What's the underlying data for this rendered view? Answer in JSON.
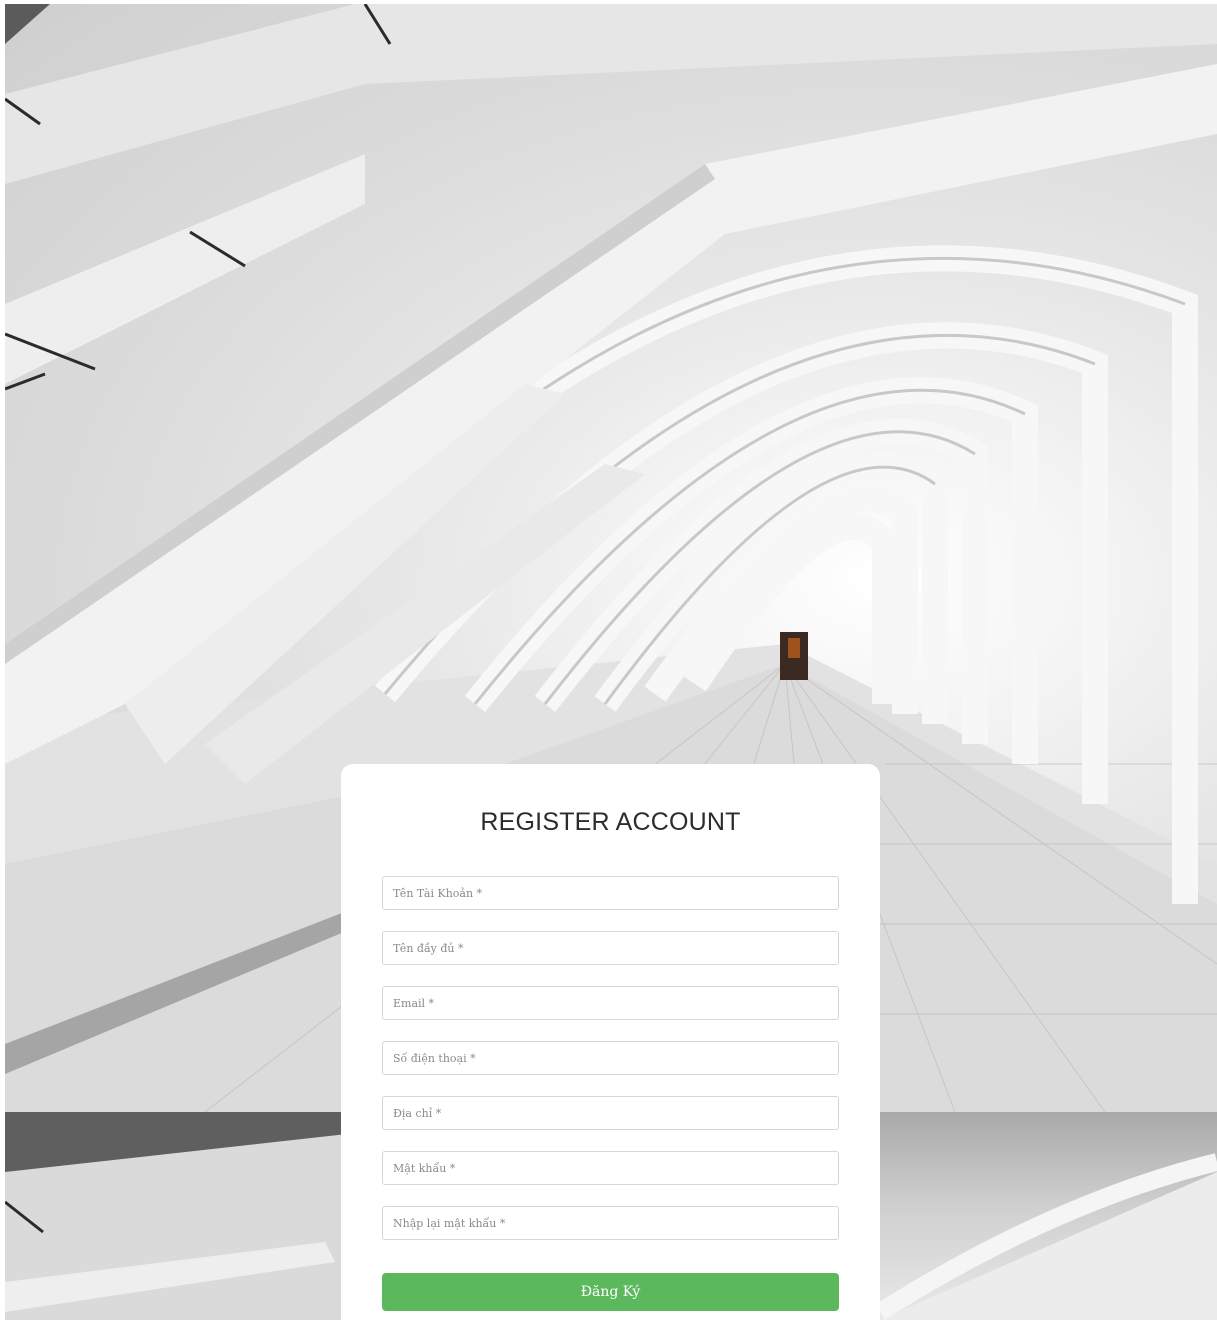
{
  "page": {
    "title": "REGISTER ACCOUNT"
  },
  "background": {
    "description_icon": "architecture-photo"
  },
  "form": {
    "fields": [
      {
        "name": "username",
        "placeholder": "Tên Tài Khoản *"
      },
      {
        "name": "fullname",
        "placeholder": "Tên đầy đủ *"
      },
      {
        "name": "email",
        "placeholder": "Email *"
      },
      {
        "name": "phone",
        "placeholder": "Số điện thoại *"
      },
      {
        "name": "address",
        "placeholder": "Địa chỉ *"
      },
      {
        "name": "password",
        "placeholder": "Mật khẩu *"
      },
      {
        "name": "confirm_password",
        "placeholder": "Nhập lại mật khẩu *"
      }
    ],
    "submit_label": "Đăng Ký"
  },
  "colors": {
    "submit_bg": "#5cb85c",
    "card_bg": "#ffffff",
    "title_text": "#2c2c2c"
  }
}
